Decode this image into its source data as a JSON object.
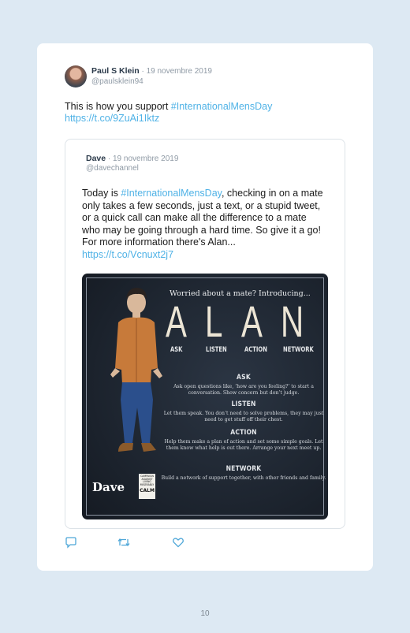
{
  "tweet": {
    "author_name": "Paul S Klein",
    "date": " · 19 novembre 2019",
    "handle": "@paulsklein94",
    "text_prefix": "This is how you support ",
    "hashtag": "#InternationalMensDay",
    "link": "https://t.co/9ZuAi1Iktz"
  },
  "quoted": {
    "author_name": "Dave",
    "date": " · 19 novembre 2019",
    "handle": "@davechannel",
    "text_prefix": "Today is ",
    "hashtag": "#InternationalMensDay",
    "text_suffix": ", checking in on a mate only takes a few seconds, just a text, or a stupid tweet, or a quick call can make all the difference to a mate who may be going through a hard time. So give it a go! For more information there's Alan... ",
    "link": "https://t.co/Vcnuxt2j7"
  },
  "poster": {
    "heading": "Worried about a mate? Introducing...",
    "letters": [
      "A",
      "L",
      "A",
      "N"
    ],
    "words": [
      "ASK",
      "LISTEN",
      "ACTION",
      "NETWORK"
    ],
    "sections": [
      {
        "title": "ASK",
        "body": "Ask open questions like, ‘how are you feeling?’ to start a conversation. Show concern but don’t judge."
      },
      {
        "title": "LISTEN",
        "body": "Let them speak. You don’t need to solve problems, they may just need to get stuff off their chest."
      },
      {
        "title": "ACTION",
        "body": "Help them make a plan of action and set some simple goals. Let them know what help is out there. Arrange your next meet up."
      },
      {
        "title": "NETWORK",
        "body": "Build a network of support together, with other friends and family."
      }
    ],
    "logo": "Dave",
    "badge_lines": [
      "CAMPAIGN",
      "AGAINST",
      "LIVING",
      "MISERABLY"
    ],
    "badge_word": "CALM"
  },
  "actions": {
    "reply_icon": "reply-icon",
    "retweet_icon": "retweet-icon",
    "like_icon": "heart-icon"
  },
  "page_number": "10",
  "colors": {
    "background": "#dde9f3",
    "link": "#4fb2e6",
    "poster_bg": "#1b222c",
    "letter_cream": "#ece5d5"
  }
}
